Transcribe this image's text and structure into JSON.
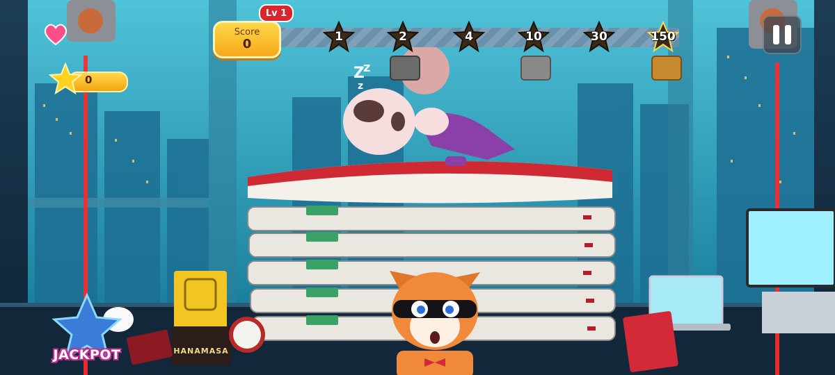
{
  "hud": {
    "score_label": "Score",
    "score_value": "0",
    "level_label": "Lv 1",
    "star_count": "0"
  },
  "milestones": [
    {
      "label": "1",
      "reached": false
    },
    {
      "label": "2",
      "reached": false
    },
    {
      "label": "4",
      "reached": false
    },
    {
      "label": "10",
      "reached": false
    },
    {
      "label": "30",
      "reached": false
    },
    {
      "label": "150",
      "reached": false
    }
  ],
  "chests": [
    {
      "type": "wood",
      "color": "#6b6b6b"
    },
    {
      "type": "silver",
      "color": "#8a8a8a"
    },
    {
      "type": "gold",
      "color": "#c88a30"
    }
  ],
  "icons": {
    "heart": "heart-icon",
    "star": "star-icon",
    "pause": "pause-icon",
    "chest": "chest-icon"
  },
  "colors": {
    "score_gold": "#f5b31f",
    "laser_red": "#ff2a2a",
    "level_red": "#d8252e",
    "sky": "#2a9ec0"
  },
  "scene": {
    "jackpot_label": "JACKPOT",
    "brand_label": "HANAMASA",
    "mattress_count": 5
  }
}
